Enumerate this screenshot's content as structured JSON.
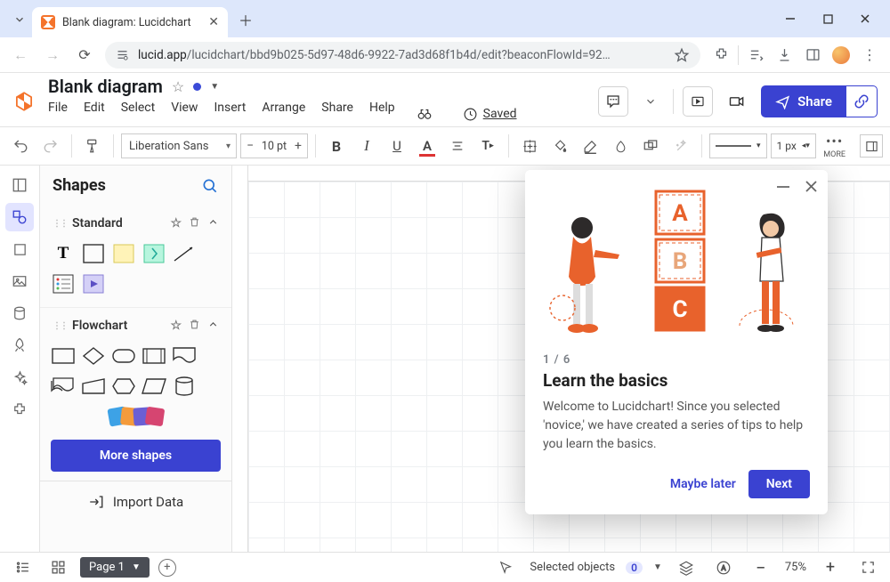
{
  "browser": {
    "tab_title": "Blank diagram: Lucidchart",
    "url_host": "lucid.app",
    "url_path": "/lucidchart/bbd9b025-5d97-48d6-9922-7ad3d68f1b4d/edit?beaconFlowId=92…"
  },
  "header": {
    "doc_title": "Blank diagram",
    "menus": [
      "File",
      "Edit",
      "Select",
      "View",
      "Insert",
      "Arrange",
      "Share",
      "Help"
    ],
    "saved_label": "Saved",
    "share_label": "Share"
  },
  "toolbar": {
    "font": "Liberation Sans",
    "font_size": "10 pt",
    "line_weight": "1 px",
    "more_label": "MORE"
  },
  "shapes": {
    "title": "Shapes",
    "sections": {
      "standard": "Standard",
      "flowchart": "Flowchart"
    },
    "more_shapes": "More shapes",
    "import": "Import Data"
  },
  "tip": {
    "step": "1 / 6",
    "title": "Learn the basics",
    "body": "Welcome to Lucidchart! Since you selected 'novice,' we have created a series of tips to help you learn the basics.",
    "maybe_later": "Maybe later",
    "next": "Next",
    "blocks": [
      "A",
      "B",
      "C"
    ]
  },
  "statusbar": {
    "page": "Page 1",
    "selected_label": "Selected objects",
    "selected_count": "0",
    "zoom": "75%"
  }
}
